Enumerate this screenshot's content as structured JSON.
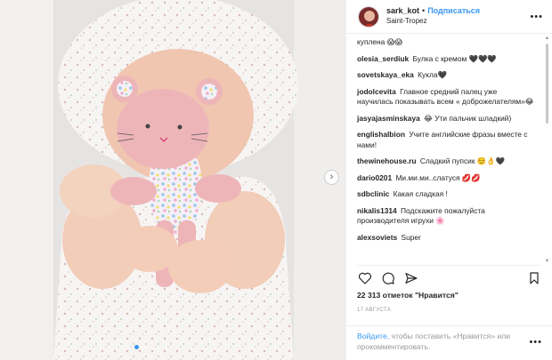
{
  "colors": {
    "accent": "#3897f0",
    "text": "#262626",
    "muted": "#999999",
    "divider": "#efefef"
  },
  "header": {
    "username": "sark_kot",
    "separator": "•",
    "follow_label": "Подписаться",
    "location": "Saint-Tropez",
    "more_label": "•••"
  },
  "photo": {
    "slide_count": 2,
    "active_slide": 1,
    "next_icon": "chevron-right-icon"
  },
  "comments": [
    {
      "user": "",
      "text": "куплена 😱😱"
    },
    {
      "user": "olesia_serdiuk",
      "text": "Булка с кремом 🖤🖤🖤"
    },
    {
      "user": "sovetskaya_eka",
      "text": "Кукла🖤"
    },
    {
      "user": "jodolcevita",
      "text": "Главное средний палец уже научилась показывать всем « доброжелателям»😂"
    },
    {
      "user": "jasyajasminskaya",
      "text": "😂 Ути пальчик шладкий)"
    },
    {
      "user": "englishalbion",
      "text": "Учите английские фразы вместе с нами!"
    },
    {
      "user": "thewinehouse.ru",
      "text": "Сладкий пупсик ☺️👌🖤"
    },
    {
      "user": "dario0201",
      "text": "Ми.ми.ми..слатуся 💋💋"
    },
    {
      "user": "sdbclinic",
      "text": "Какая сладкая !"
    },
    {
      "user": "nikalis1314",
      "text": "Подскажите пожалуйста производителя игрухи 🌸"
    },
    {
      "user": "alexsoviets",
      "text": "Super"
    }
  ],
  "actions": {
    "like_icon": "heart-icon",
    "comment_icon": "comment-icon",
    "share_icon": "share-icon",
    "save_icon": "bookmark-icon"
  },
  "likes_text": "22 313 отметок \"Нравится\"",
  "date_text": "17 АВГУСТА",
  "footer": {
    "login_label": "Войдите,",
    "rest_text": " чтобы поставить «Нравится» или прокомментировать.",
    "more_label": "•••"
  }
}
